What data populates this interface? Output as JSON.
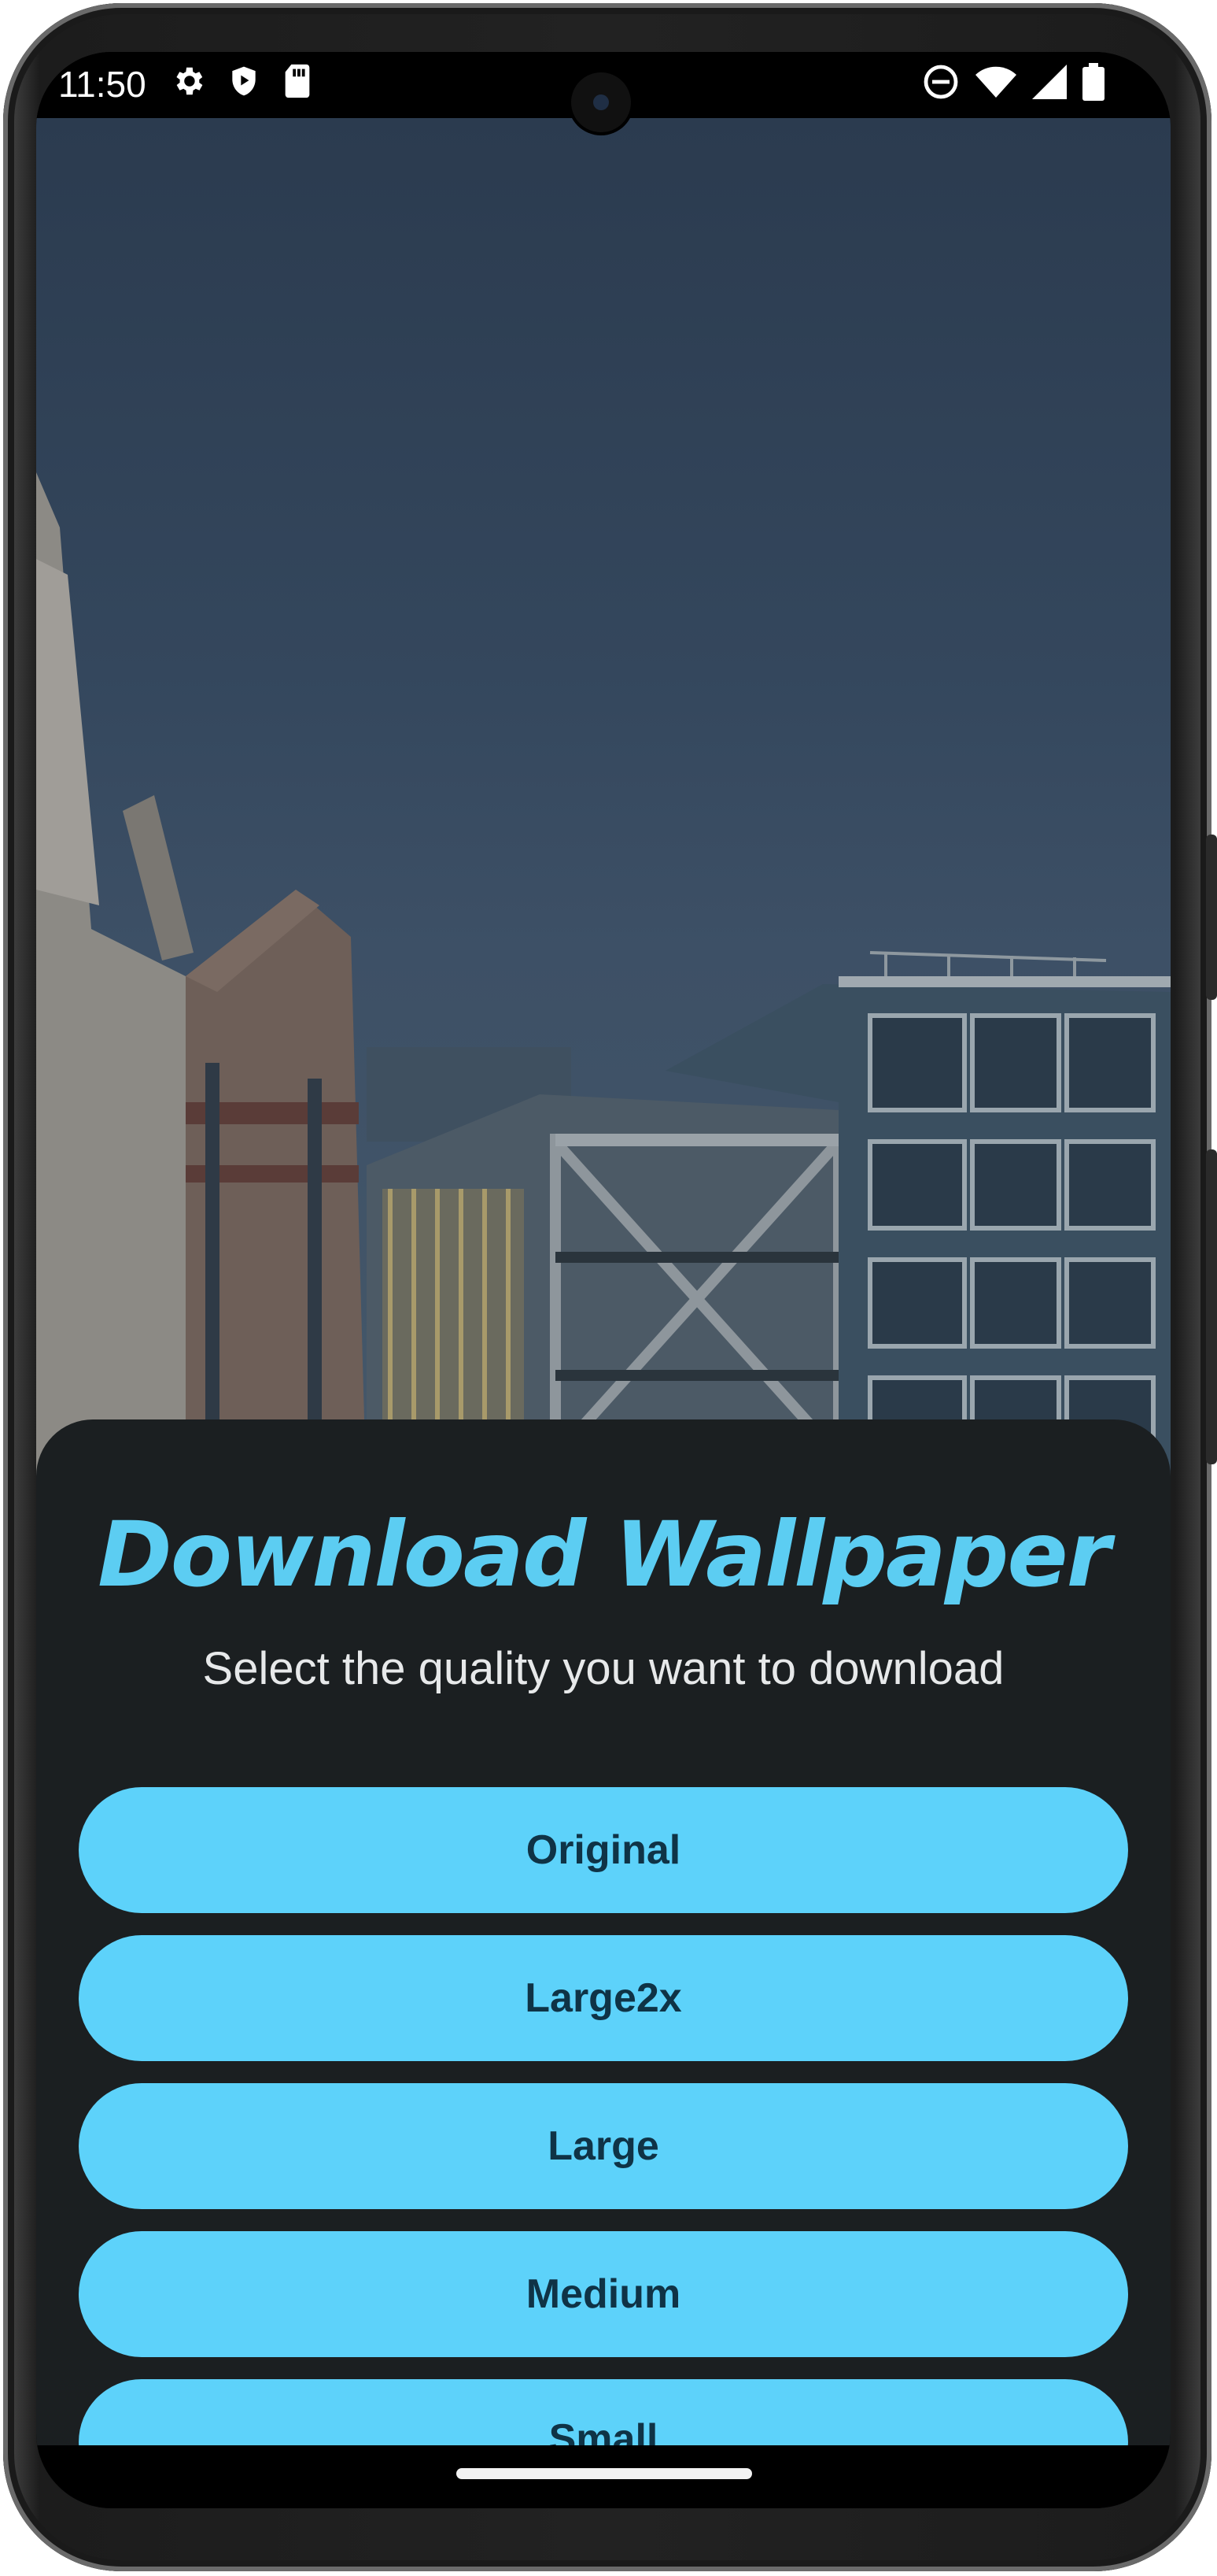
{
  "status_bar": {
    "time": "11:50",
    "left_icons": [
      "settings-gear-icon",
      "shield-play-icon",
      "sd-card-icon"
    ],
    "right_icons": [
      "do-not-disturb-icon",
      "wifi-icon",
      "signal-icon",
      "battery-icon"
    ]
  },
  "dialog": {
    "title": "Download Wallpaper",
    "subtitle": "Select the quality you want to download",
    "options": [
      "Original",
      "Large2x",
      "Large",
      "Medium",
      "Small"
    ]
  },
  "colors": {
    "accent": "#5dd2fa",
    "sheet_background": "#1b1f21",
    "button_text": "#0f3346"
  }
}
